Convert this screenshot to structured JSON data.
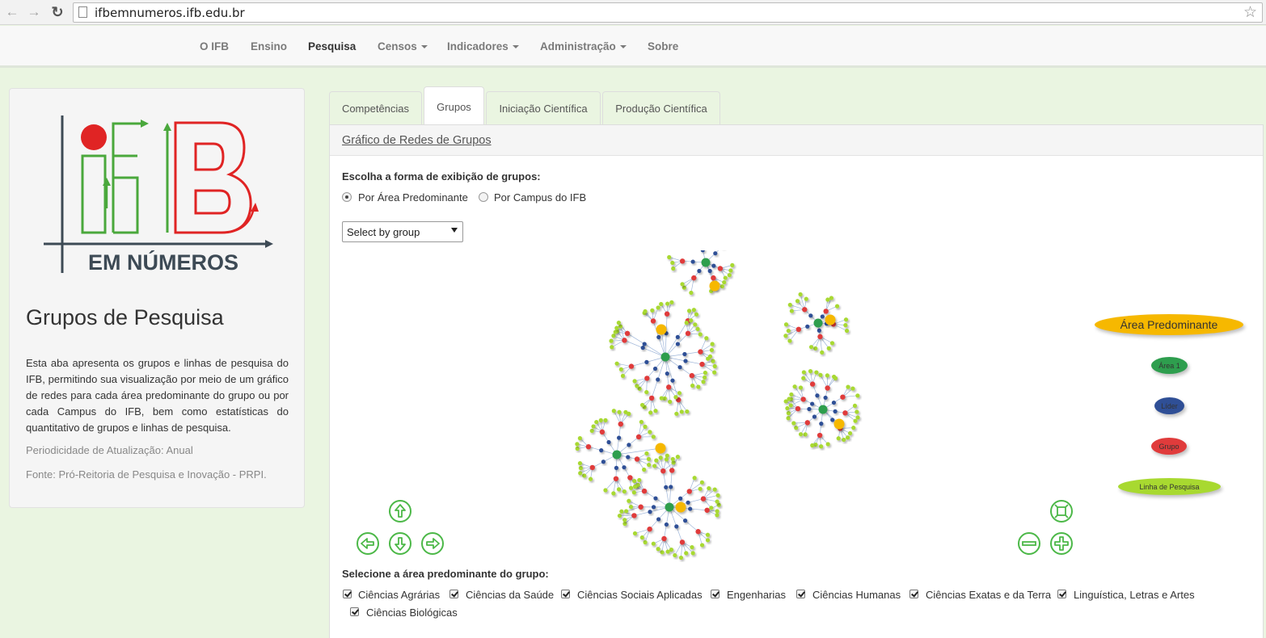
{
  "browser": {
    "url": "ifbemnumeros.ifb.edu.br"
  },
  "nav": {
    "items": [
      {
        "label": "O IFB",
        "dropdown": false,
        "active": false
      },
      {
        "label": "Ensino",
        "dropdown": false,
        "active": false
      },
      {
        "label": "Pesquisa",
        "dropdown": false,
        "active": true
      },
      {
        "label": "Censos",
        "dropdown": true,
        "active": false
      },
      {
        "label": "Indicadores",
        "dropdown": true,
        "active": false
      },
      {
        "label": "Administração",
        "dropdown": true,
        "active": false
      },
      {
        "label": "Sobre",
        "dropdown": false,
        "active": false
      }
    ]
  },
  "sidebar": {
    "logo_text": "EM NÚMEROS",
    "title": "Grupos de Pesquisa",
    "description": "Esta aba apresenta os grupos e linhas de pesquisa do IFB, permitindo sua visualização por meio de um gráfico de redes para cada área predominante do grupo ou por cada Campus do IFB, bem como estatísticas do quantitativo de grupos e linhas de pesquisa.",
    "update_period": "Periodicidade de Atualização: Anual",
    "source": "Fonte: Pró-Reitoria de Pesquisa e Inovação - PRPI."
  },
  "tabs": [
    {
      "label": "Competências",
      "active": false
    },
    {
      "label": "Grupos",
      "active": true
    },
    {
      "label": "Iniciação Científica",
      "active": false
    },
    {
      "label": "Produção Científica",
      "active": false
    }
  ],
  "panel": {
    "heading": "Gráfico de Redes de Grupos",
    "display_label": "Escolha a forma de exibição de grupos:",
    "radio_area": "Por Área Predominante",
    "radio_campus": "Por Campus do IFB",
    "selected_radio": "area",
    "select_value": "Select by group",
    "area_select_label": "Selecione a área predominante do grupo:"
  },
  "legend": {
    "title": "Área Predominante",
    "items": [
      {
        "label": "Área 1",
        "color": "#2e9e4e"
      },
      {
        "label": "Líder",
        "color": "#2f4f96"
      },
      {
        "label": "Grupo",
        "color": "#e03b3b"
      },
      {
        "label": "Linha de Pesquisa",
        "color": "#a8d930"
      }
    ],
    "title_color": "#f6b800"
  },
  "areas": [
    {
      "label": "Ciências Agrárias",
      "checked": true
    },
    {
      "label": "Ciências da Saúde",
      "checked": true
    },
    {
      "label": "Ciências Sociais Aplicadas",
      "checked": true
    },
    {
      "label": "Engenharias",
      "checked": true
    },
    {
      "label": "Ciências Humanas",
      "checked": true
    },
    {
      "label": "Ciências Exatas e da Terra",
      "checked": true
    },
    {
      "label": "Linguística, Letras e Artes",
      "checked": true
    },
    {
      "label": "Ciências Biológicas",
      "checked": true
    }
  ],
  "colors": {
    "control_green": "#4cb848",
    "page_bg": "#eaf5e1"
  },
  "controls": [
    "arrow-up-icon",
    "arrow-left-icon",
    "arrow-down-icon",
    "arrow-right-icon",
    "zoom-extends-icon",
    "zoom-out-icon",
    "zoom-in-icon"
  ]
}
